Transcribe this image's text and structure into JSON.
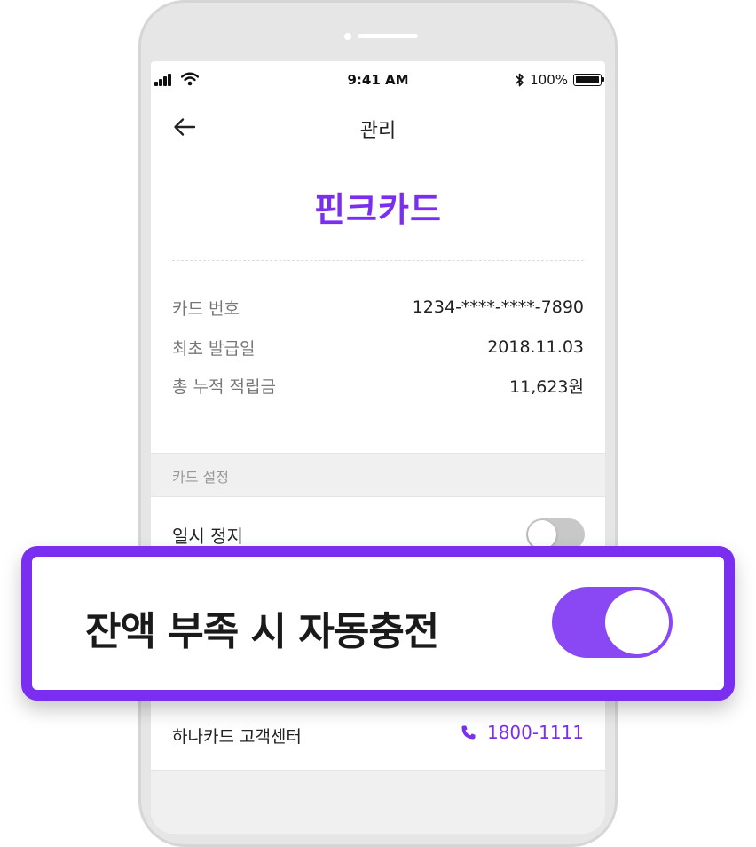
{
  "status_bar": {
    "time": "9:41 AM",
    "battery": "100%",
    "icons": [
      "signal-icon",
      "wifi-icon",
      "bluetooth-icon",
      "battery-icon"
    ]
  },
  "header": {
    "title": "관리",
    "back_icon": "arrow-left-icon"
  },
  "card": {
    "name": "핀크카드"
  },
  "info": [
    {
      "label": "카드 번호",
      "value": "1234-****-****-7890"
    },
    {
      "label": "최초 발급일",
      "value": "2018.11.03"
    },
    {
      "label": "총 누적 적립금",
      "value": "11,623원"
    }
  ],
  "settings": {
    "section_title": "카드 설정",
    "pause": {
      "label": "일시 정지",
      "on": false
    },
    "auto_charge": {
      "label": "잔액 부족 시 자동충전",
      "on": true
    }
  },
  "support": {
    "label": "하나카드 고객센터",
    "phone": "1800-1111",
    "icon": "phone-icon"
  },
  "colors": {
    "accent": "#7a2ff0",
    "toggle_on": "#8a48f5",
    "toggle_off": "#c8c8c8",
    "phone_body": "#e6e6e6"
  }
}
